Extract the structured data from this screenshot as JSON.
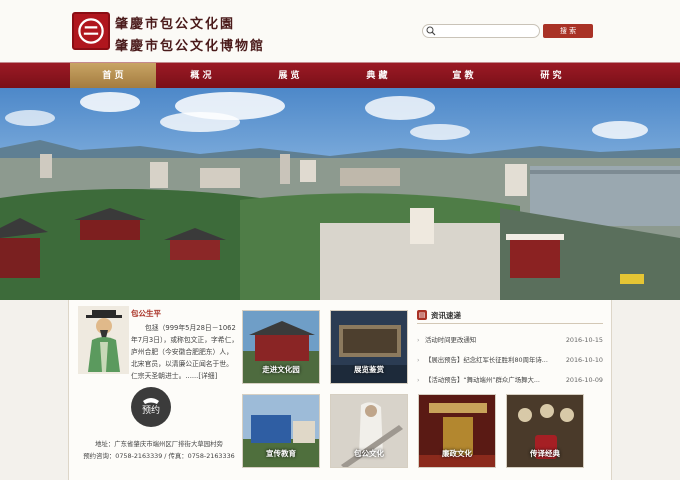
{
  "header": {
    "title_line1": "肇慶市包公文化園",
    "title_line2": "肇慶市包公文化博物館",
    "search": {
      "placeholder": "",
      "button_label": "搜 索"
    }
  },
  "nav": {
    "items": [
      {
        "label": "首 页",
        "active": true
      },
      {
        "label": "概 况",
        "active": false
      },
      {
        "label": "展 览",
        "active": false
      },
      {
        "label": "典 藏",
        "active": false
      },
      {
        "label": "宣 教",
        "active": false
      },
      {
        "label": "研 究",
        "active": false
      }
    ]
  },
  "bio": {
    "title": "包公生平",
    "text": "包拯（999年5月28日－1062年7月3日），或称包文正，字希仁，庐州合肥（今安徽合肥肥东）人，北宋官员，以清廉公正闻名于世。仁宗天圣朝进士。......[详细]",
    "booking_label": "预约",
    "address": "地址：广东省肇庆市端州区厂排街大草园村旁",
    "contact": "预约咨询：0758-2163339 / 传真：0758-2163336"
  },
  "tiles": [
    {
      "label": "走进文化园"
    },
    {
      "label": "展览鉴赏"
    },
    {
      "label": "宣传教育"
    },
    {
      "label": "包公文化"
    },
    {
      "label": "廉政文化"
    },
    {
      "label": "传译经典"
    }
  ],
  "news": {
    "title": "资讯速递",
    "items": [
      {
        "text": "活动时间更改通知",
        "date": "2016-10-15"
      },
      {
        "text": "【展出预告】纪念红军长征胜利80周年诗...",
        "date": "2016-10-10"
      },
      {
        "text": "【活动预告】“舞动端州”群众广场舞大...",
        "date": "2016-10-09"
      }
    ]
  }
}
